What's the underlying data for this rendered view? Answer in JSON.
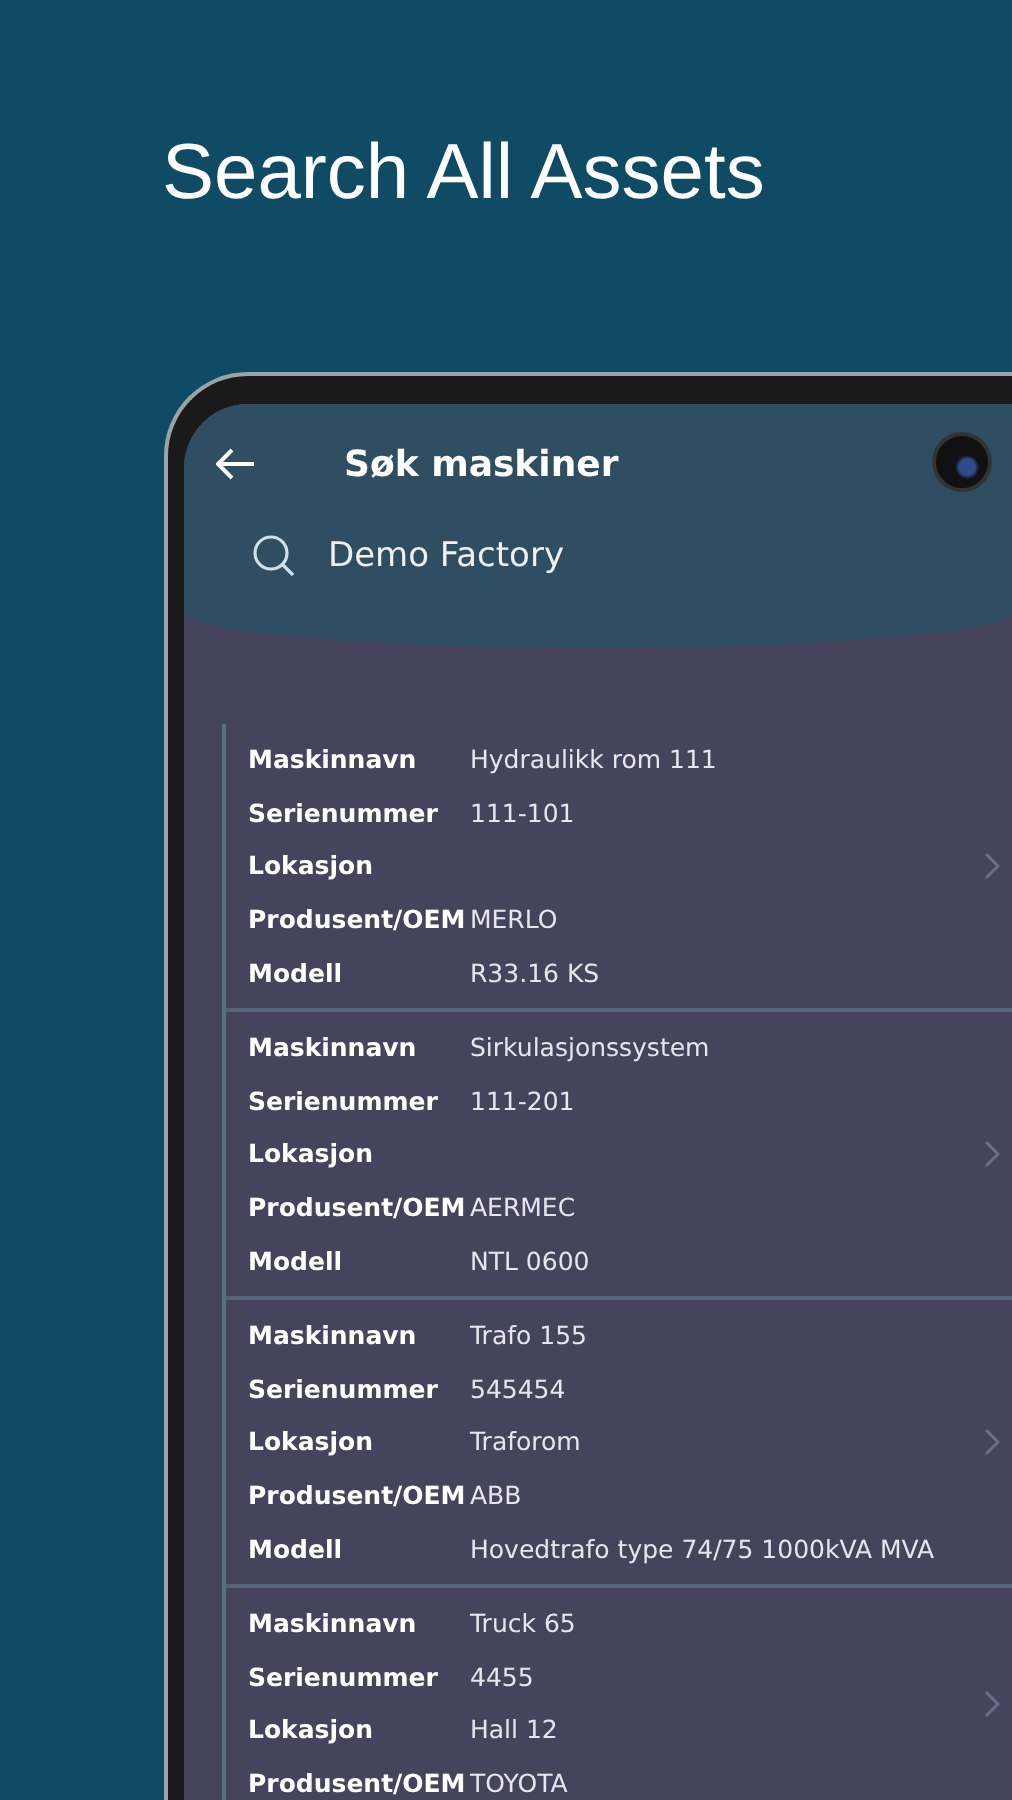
{
  "headline": "Search All Assets",
  "app_bar": {
    "title": "Søk maskiner"
  },
  "search": {
    "value": "Demo Factory"
  },
  "assets": [
    {
      "fields": [
        {
          "label": "Maskinnavn",
          "value": "Hydraulikk rom 111"
        },
        {
          "label": "Serienummer",
          "value": "111-101"
        },
        {
          "label": "Lokasjon"
        },
        {
          "label": "Produsent/OEM",
          "value": "MERLO"
        },
        {
          "label": "Modell",
          "value": "R33.16 KS"
        }
      ]
    },
    {
      "fields": [
        {
          "label": "Maskinnavn",
          "value": "Sirkulasjonssystem"
        },
        {
          "label": "Serienummer",
          "value": "111-201"
        },
        {
          "label": "Lokasjon"
        },
        {
          "label": "Produsent/OEM",
          "value": "AERMEC"
        },
        {
          "label": "Modell",
          "value": "NTL 0600"
        }
      ]
    },
    {
      "fields": [
        {
          "label": "Maskinnavn",
          "value": "Trafo 155"
        },
        {
          "label": "Serienummer",
          "value": "545454"
        },
        {
          "label": "Lokasjon",
          "value": "Traforom"
        },
        {
          "label": "Produsent/OEM",
          "value": "ABB"
        },
        {
          "label": "Modell",
          "value": "Hovedtrafo type 74/75 1000kVA MVA"
        }
      ]
    },
    {
      "fields": [
        {
          "label": "Maskinnavn",
          "value": "Truck 65"
        },
        {
          "label": "Serienummer",
          "value": "4455"
        },
        {
          "label": "Lokasjon",
          "value": "Hall 12"
        },
        {
          "label": "Produsent/OEM",
          "value": "TOYOTA"
        }
      ]
    }
  ]
}
